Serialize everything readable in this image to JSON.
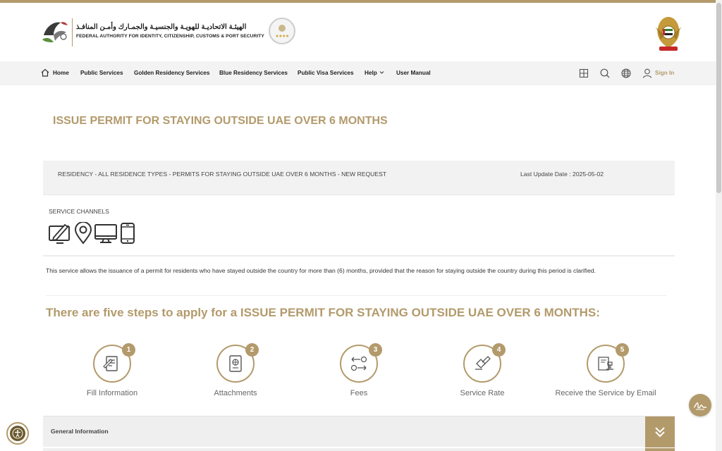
{
  "header": {
    "org_name_ar": "الهيئـة الاتحاديـة للهويـة والجنسيـة والجمـارك وأمـن المنافـذ",
    "org_name_en": "FEDERAL AUTHORITY FOR IDENTITY, CITIZENSHIP, CUSTOMS & PORT SECURITY",
    "rating_stars": "★★★★"
  },
  "nav": {
    "items": [
      {
        "label": "Home"
      },
      {
        "label": "Public Services"
      },
      {
        "label": "Golden Residency Services"
      },
      {
        "label": "Blue Residency Services"
      },
      {
        "label": "Public Visa Services"
      },
      {
        "label": "Help"
      },
      {
        "label": "User Manual"
      }
    ],
    "sign_in": "Sign In",
    "tools": [
      "grid-icon",
      "search-icon",
      "globe-icon",
      "user-icon"
    ]
  },
  "page": {
    "title": "ISSUE PERMIT FOR STAYING OUTSIDE UAE OVER 6 MONTHS",
    "breadcrumb": "RESIDENCY - ALL RESIDENCE TYPES - PERMITS FOR STAYING OUTSIDE UAE OVER 6 MONTHS - NEW REQUEST",
    "last_update": "Last Update Date : 2025-05-02",
    "channels_title": "SERVICE CHANNELS",
    "channels": [
      "computer-pen-icon",
      "location-pin-icon",
      "desktop-icon",
      "mobile-icon"
    ],
    "description": "This service allows the issuance of a permit for residents who have stayed outside the country for more than (6) months, provided that the reason for staying outside the country during this period is clarified.",
    "steps_title": "There are five steps to apply for a ISSUE PERMIT FOR STAYING OUTSIDE UAE OVER 6 MONTHS:",
    "steps": [
      {
        "num": "1",
        "label": "Fill Information",
        "icon": "form-pen-icon"
      },
      {
        "num": "2",
        "label": "Attachments",
        "icon": "passport-icon"
      },
      {
        "num": "3",
        "label": "Fees",
        "icon": "money-exchange-icon"
      },
      {
        "num": "4",
        "label": "Service Rate",
        "icon": "thumbs-rating-icon"
      },
      {
        "num": "5",
        "label": "Receive the Service by Email",
        "icon": "stamp-document-icon"
      }
    ],
    "accordion": {
      "label": "General Information"
    }
  },
  "colors": {
    "accent": "#b39a6b",
    "panel": "#f2f2f2",
    "text": "#333333"
  }
}
